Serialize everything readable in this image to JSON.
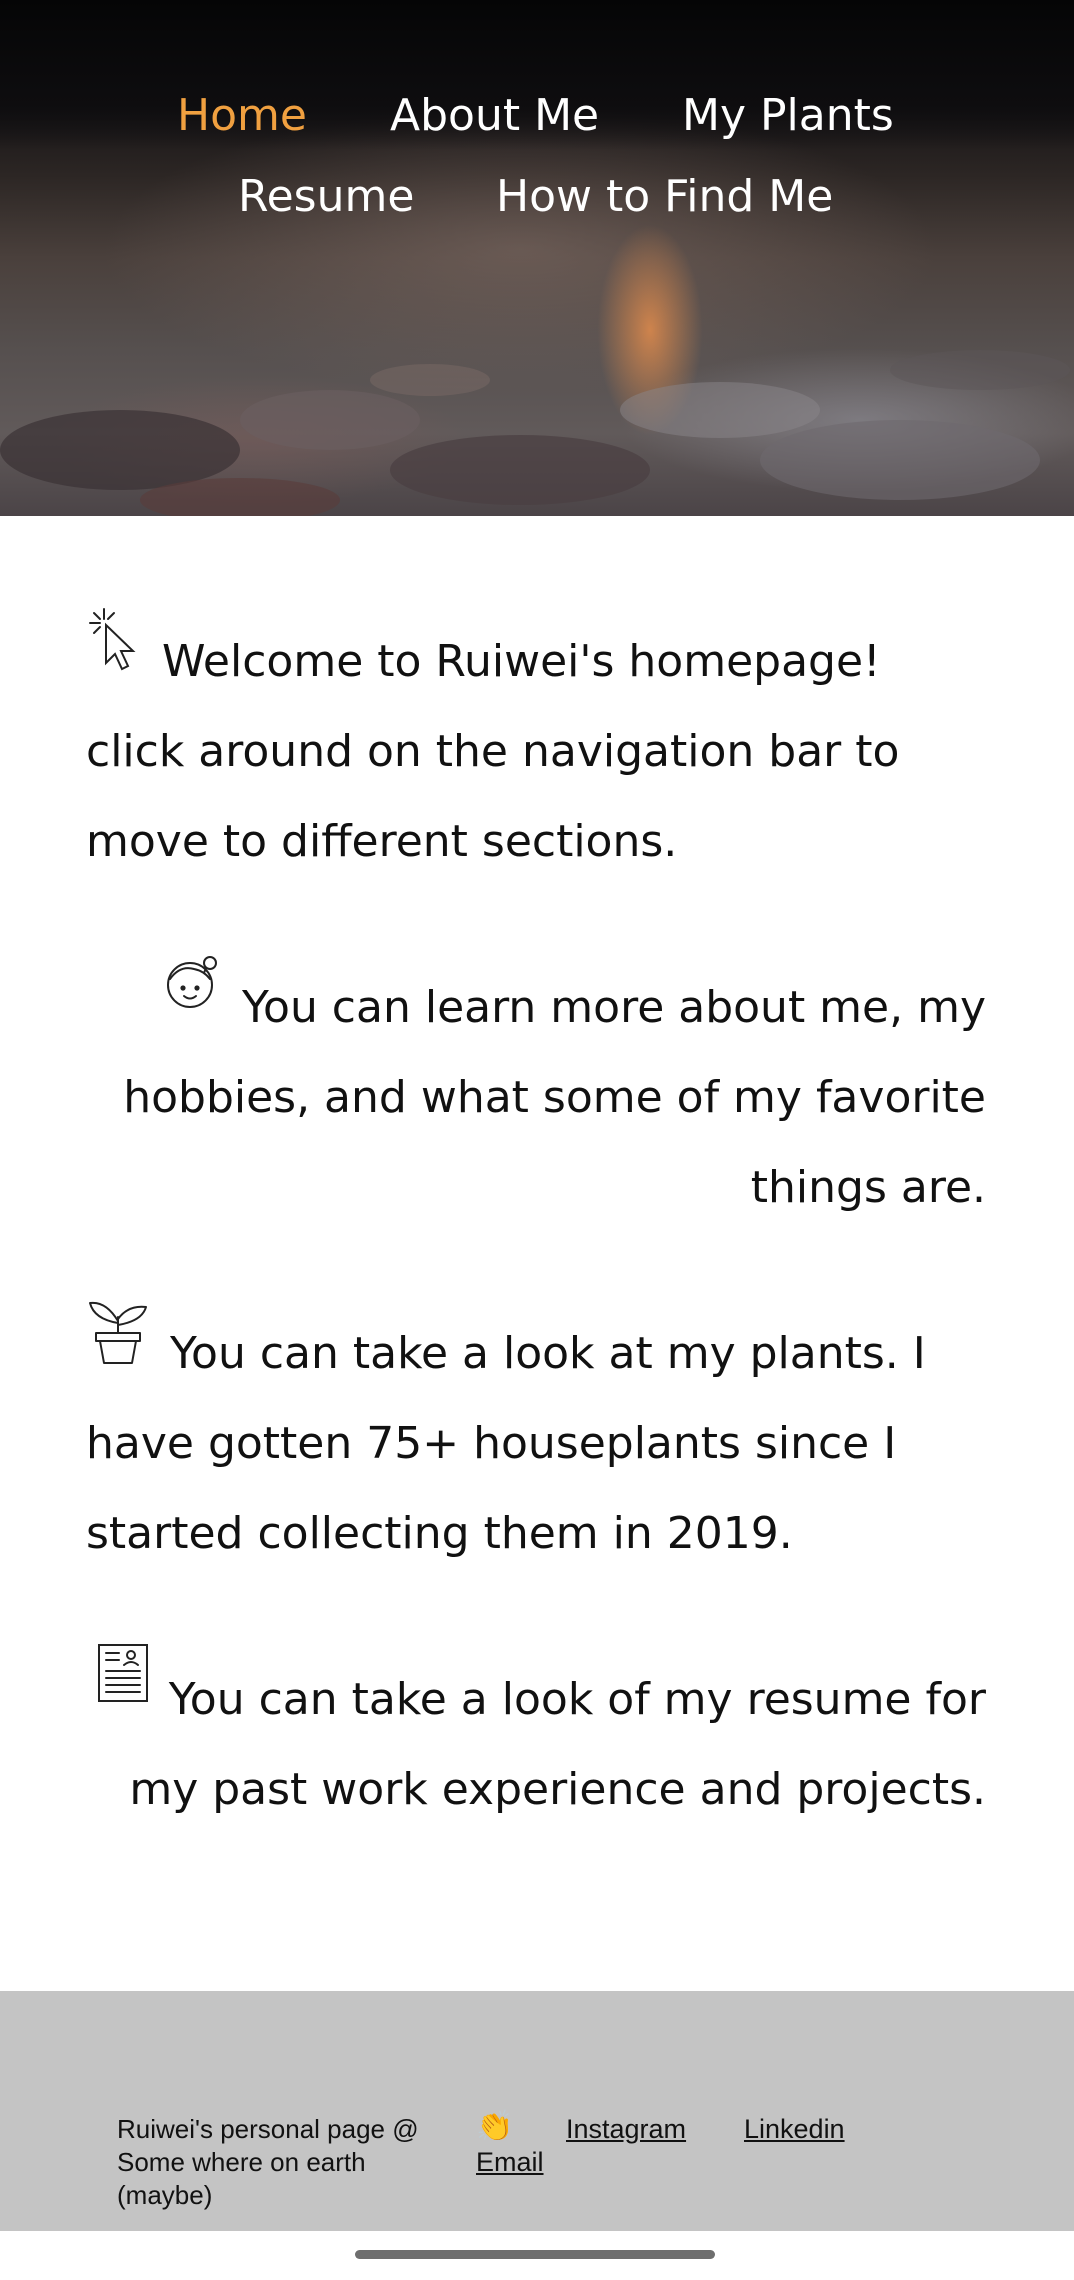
{
  "nav": {
    "items": [
      {
        "label": "Home",
        "active": true
      },
      {
        "label": "About Me",
        "active": false
      },
      {
        "label": "My Plants",
        "active": false
      },
      {
        "label": "Resume",
        "active": false
      },
      {
        "label": "How to Find Me",
        "active": false
      }
    ],
    "active_color": "#f0a040"
  },
  "sections": [
    {
      "icon": "cursor-click-icon",
      "align": "left",
      "text": "Welcome to Ruiwei's homepage! click around on the navigation bar to move to different sections."
    },
    {
      "icon": "girl-face-icon",
      "align": "right",
      "text": "You can learn more about me, my hobbies, and what some of my favorite things are."
    },
    {
      "icon": "potted-plant-icon",
      "align": "left",
      "text": "You can take a look at my plants. I have gotten 75+ houseplants since I started collecting them in 2019."
    },
    {
      "icon": "resume-document-icon",
      "align": "right",
      "text": "You can take a look of my resume for my past work experience and projects."
    }
  ],
  "footer": {
    "info": "Ruiwei's personal page @ Some where on earth (maybe)",
    "wave": "👏",
    "links": {
      "instagram": "Instagram",
      "linkedin": "Linkedin",
      "email": "Email"
    },
    "background": "#c4c4c4"
  }
}
